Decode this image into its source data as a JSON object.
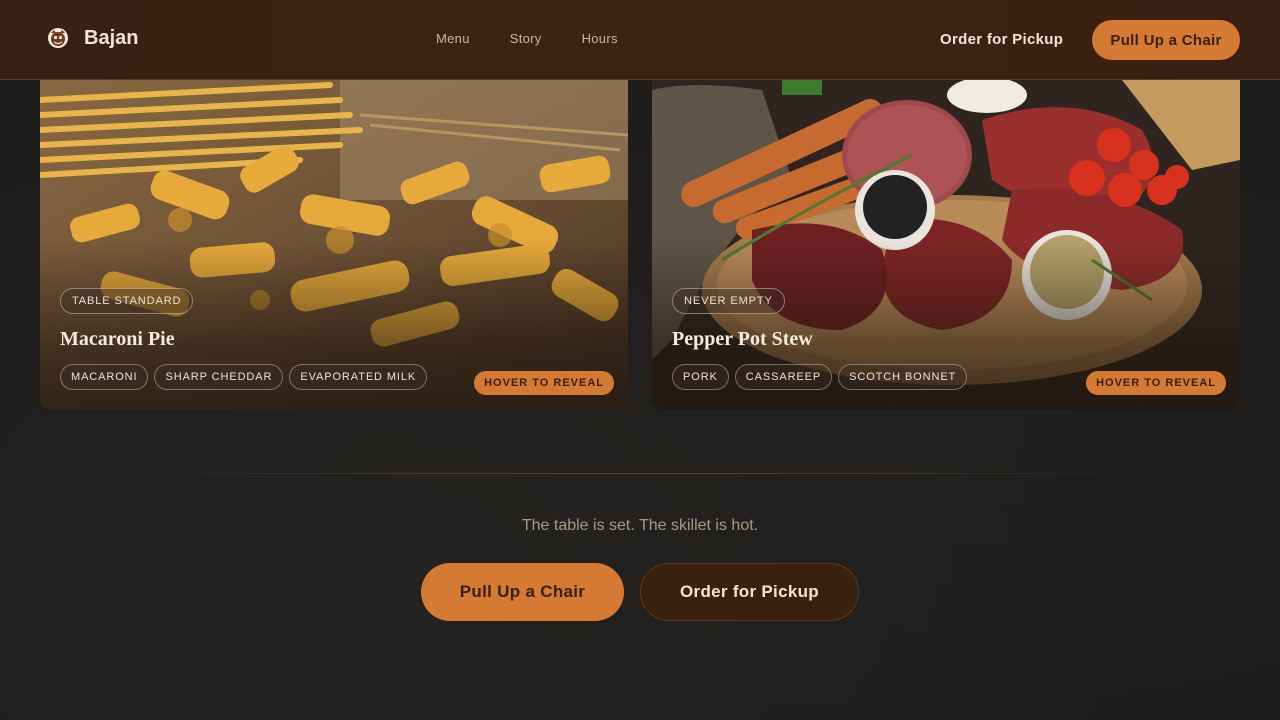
{
  "header": {
    "brand": "Bajan",
    "nav": [
      "Menu",
      "Story",
      "Hours"
    ],
    "order_link": "Order for Pickup",
    "cta": "Pull Up a Chair"
  },
  "cards": [
    {
      "badge": "TABLE STANDARD",
      "title": "Macaroni Pie",
      "tags": [
        "MACARONI",
        "SHARP CHEDDAR",
        "EVAPORATED MILK"
      ],
      "reveal": "HOVER TO REVEAL"
    },
    {
      "badge": "NEVER EMPTY",
      "title": "Pepper Pot Stew",
      "tags": [
        "PORK",
        "CASSAREEP",
        "SCOTCH BONNET"
      ],
      "reveal": "HOVER TO REVEAL"
    }
  ],
  "footer_cta": {
    "tagline": "The table is set. The skillet is hot.",
    "primary": "Pull Up a Chair",
    "secondary": "Order for Pickup"
  },
  "colors": {
    "accent": "#d47a33",
    "header_bg": "#3a2012",
    "page_bg": "#1e1d1c"
  },
  "icons": [
    "bajan-logo-icon"
  ]
}
